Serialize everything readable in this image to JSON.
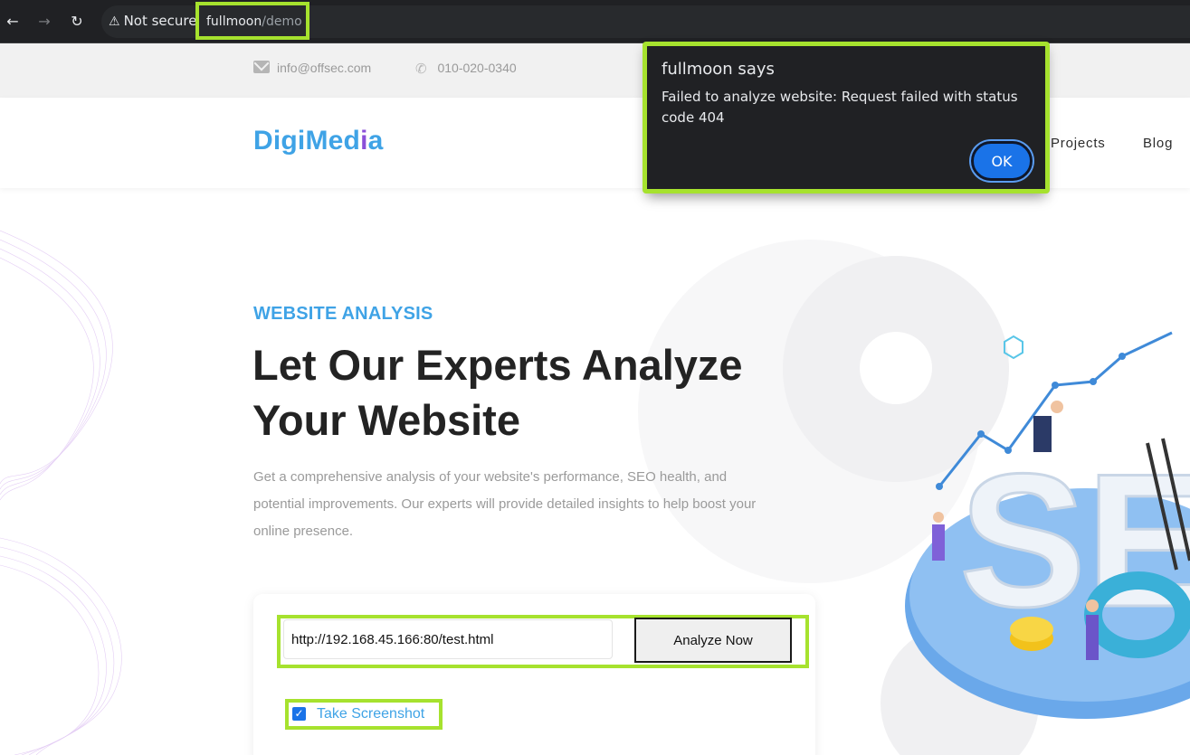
{
  "browser": {
    "not_secure": "Not secure",
    "url_host": "fullmoon",
    "url_path": "/demo"
  },
  "topbar": {
    "email": "info@offsec.com",
    "phone": "010-020-0340"
  },
  "header": {
    "logo_part1": "DigiMed",
    "logo_accent": "i",
    "logo_part2": "a",
    "menu": [
      "Projects",
      "Blog"
    ]
  },
  "hero": {
    "eyebrow": "WEBSITE ANALYSIS",
    "title": "Let Our Experts Analyze Your Website",
    "description": "Get a comprehensive analysis of your website's performance, SEO health, and potential improvements. Our experts will provide detailed insights to help boost your online presence."
  },
  "form": {
    "url_value": "http://192.168.45.166:80/test.html",
    "analyze_label": "Analyze Now",
    "screenshot_label": "Take Screenshot",
    "screenshot_checked": true
  },
  "dialog": {
    "title": "fullmoon says",
    "message": "Failed to analyze website: Request failed with status code 404",
    "ok_label": "OK"
  },
  "colors": {
    "accent": "#3fa3e6",
    "logo_i": "#8b4fd8",
    "highlight": "#a6e22e",
    "button_blue": "#1a73e8"
  }
}
